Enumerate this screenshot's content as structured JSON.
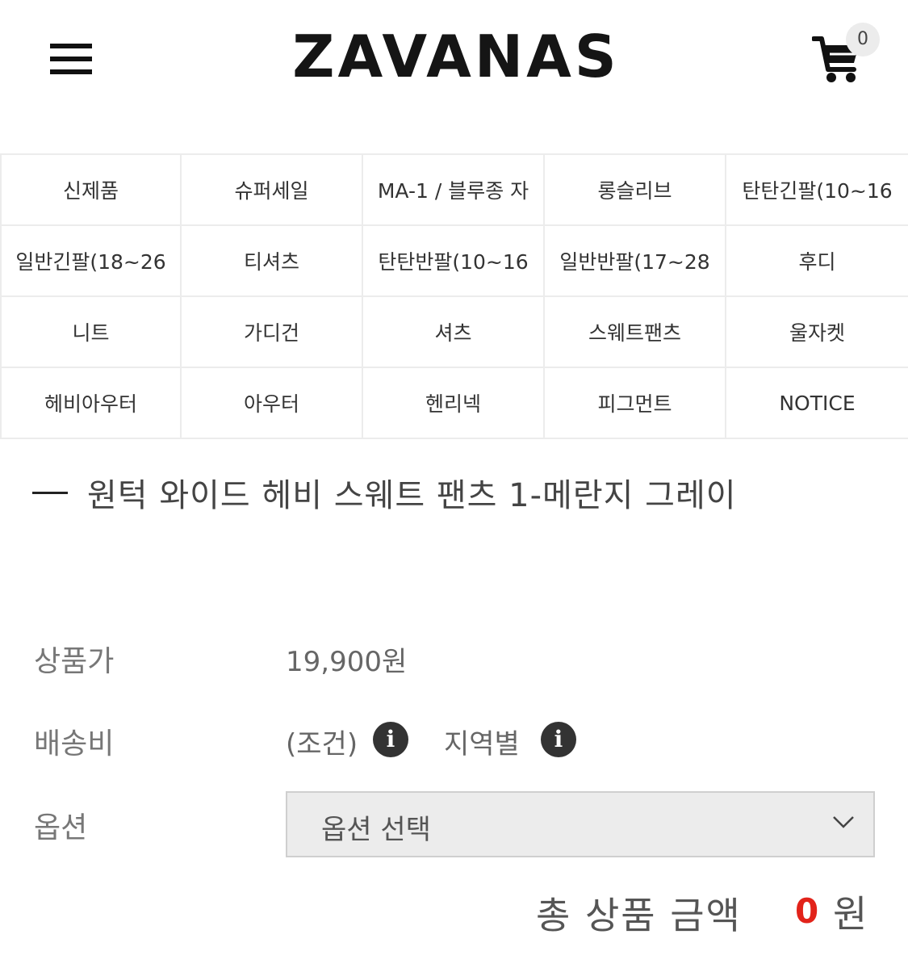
{
  "header": {
    "logo": "ZAVANAS",
    "cart_count": "0"
  },
  "categories": [
    "신제품",
    "슈퍼세일",
    "MA-1 / 블루종 자",
    "롱슬리브",
    "탄탄긴팔(10~16",
    "일반긴팔(18~26",
    "티셔츠",
    "탄탄반팔(10~16",
    "일반반팔(17~28",
    "후디",
    "니트",
    "가디건",
    "셔츠",
    "스웨트팬츠",
    "울자켓",
    "헤비아우터",
    "아우터",
    "헨리넥",
    "피그먼트",
    "NOTICE"
  ],
  "product": {
    "title": "원턱 와이드 헤비 스웨트 팬츠 1-메란지 그레이",
    "price_label": "상품가",
    "price": "19,900원",
    "shipping_label": "배송비",
    "shipping_condition": "(조건)",
    "shipping_region": "지역별",
    "option_label": "옵션",
    "option_select": "옵션 선택",
    "total_label": "총 상품 금액",
    "total_value": "0",
    "total_unit": "원"
  },
  "colors": {
    "accent_red": "#e2231a",
    "text": "#333333",
    "border": "#ececec"
  }
}
